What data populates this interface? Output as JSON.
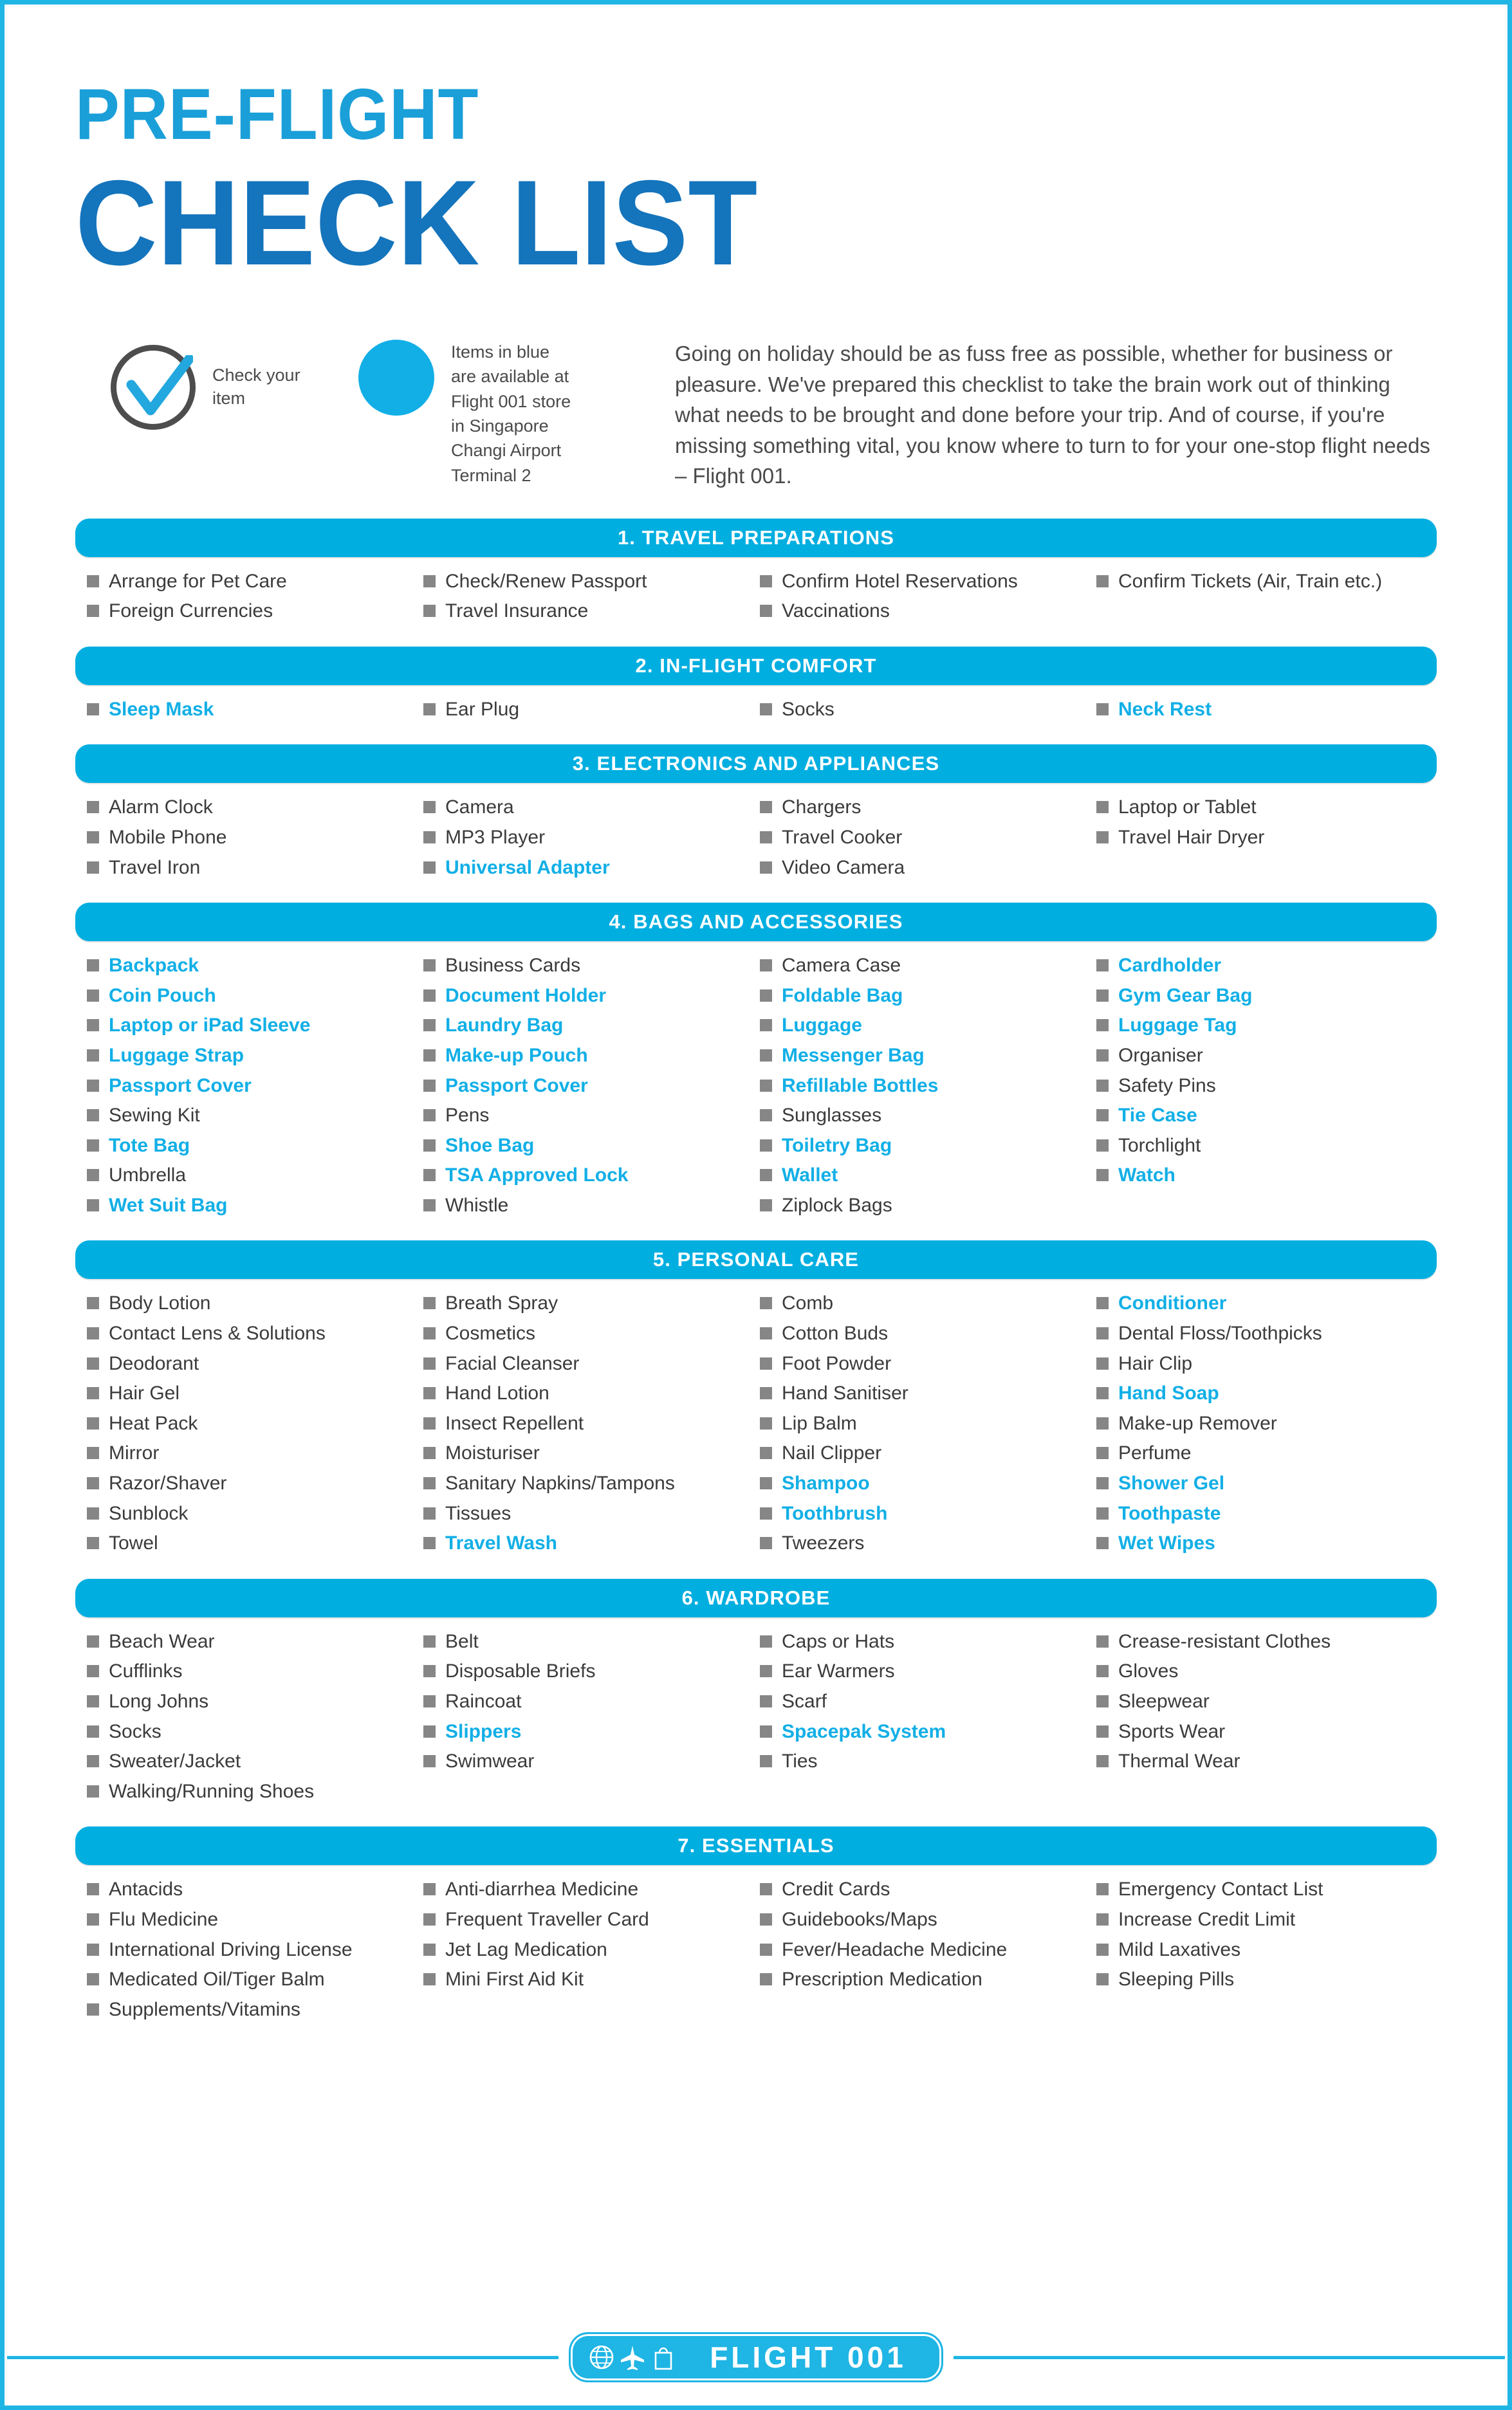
{
  "title": {
    "line1": "PRE-FLIGHT",
    "line2": "CHECK LIST",
    "color_line1": "#1B9FD8",
    "color_line2": "#1474BC"
  },
  "legend": {
    "check_icon": "check-mark-icon",
    "check_label": "Check your\nitem",
    "blue_dot_icon": "blue-dot-icon",
    "blue_label": "Items in blue\nare available at\nFlight 001 store\nin Singapore\nChangi Airport\nTerminal 2",
    "blue_color": "#12AFE6"
  },
  "intro": {
    "paragraph": "Going on holiday should be as fuss free as possible, whether for business or pleasure. We've prepared this checklist to take the brain work out of thinking what needs to be brought and done before your trip. And of course, if you're missing something vital, you know where to turn to for your one-stop flight needs – Flight 001."
  },
  "colors": {
    "section_bar": "#00AEE0",
    "highlight_text": "#12AFE6",
    "normal_text": "#3B3B3B",
    "checkbox": "#868686",
    "page_border": "#1FB5E4"
  },
  "sections": [
    {
      "title": "1. TRAVEL PREPARATIONS",
      "columns": [
        [
          {
            "label": "Arrange for Pet Care",
            "blue": false
          },
          {
            "label": "Foreign Currencies",
            "blue": false
          }
        ],
        [
          {
            "label": "Check/Renew Passport",
            "blue": false
          },
          {
            "label": "Travel Insurance",
            "blue": false
          }
        ],
        [
          {
            "label": "Confirm Hotel Reservations",
            "blue": false
          },
          {
            "label": "Vaccinations",
            "blue": false
          }
        ],
        [
          {
            "label": "Confirm Tickets (Air, Train etc.)",
            "blue": false
          }
        ]
      ]
    },
    {
      "title": "2. IN-FLIGHT COMFORT",
      "columns": [
        [
          {
            "label": "Sleep Mask",
            "blue": true
          }
        ],
        [
          {
            "label": "Ear Plug",
            "blue": false
          }
        ],
        [
          {
            "label": "Socks",
            "blue": false
          }
        ],
        [
          {
            "label": "Neck Rest",
            "blue": true
          }
        ]
      ]
    },
    {
      "title": "3. ELECTRONICS AND APPLIANCES",
      "columns": [
        [
          {
            "label": "Alarm Clock",
            "blue": false
          },
          {
            "label": "Mobile Phone",
            "blue": false
          },
          {
            "label": "Travel Iron",
            "blue": false
          }
        ],
        [
          {
            "label": "Camera",
            "blue": false
          },
          {
            "label": "MP3 Player",
            "blue": false
          },
          {
            "label": "Universal Adapter",
            "blue": true
          }
        ],
        [
          {
            "label": "Chargers",
            "blue": false
          },
          {
            "label": "Travel Cooker",
            "blue": false
          },
          {
            "label": "Video Camera",
            "blue": false
          }
        ],
        [
          {
            "label": "Laptop or Tablet",
            "blue": false
          },
          {
            "label": "Travel Hair Dryer",
            "blue": false
          }
        ]
      ]
    },
    {
      "title": "4. BAGS AND ACCESSORIES",
      "columns": [
        [
          {
            "label": "Backpack",
            "blue": true
          },
          {
            "label": "Coin Pouch",
            "blue": true
          },
          {
            "label": "Laptop or iPad Sleeve",
            "blue": true
          },
          {
            "label": "Luggage Strap",
            "blue": true
          },
          {
            "label": "Passport Cover",
            "blue": true
          },
          {
            "label": "Sewing Kit",
            "blue": false
          },
          {
            "label": "Tote Bag",
            "blue": true
          },
          {
            "label": "Umbrella",
            "blue": false
          },
          {
            "label": "Wet Suit Bag",
            "blue": true
          }
        ],
        [
          {
            "label": "Business Cards",
            "blue": false
          },
          {
            "label": "Document Holder",
            "blue": true
          },
          {
            "label": "Laundry Bag",
            "blue": true
          },
          {
            "label": "Make-up Pouch",
            "blue": true
          },
          {
            "label": "Passport Cover",
            "blue": true
          },
          {
            "label": "Pens",
            "blue": false
          },
          {
            "label": "Shoe Bag",
            "blue": true
          },
          {
            "label": "TSA Approved Lock",
            "blue": true
          },
          {
            "label": "Whistle",
            "blue": false
          }
        ],
        [
          {
            "label": "Camera Case",
            "blue": false
          },
          {
            "label": "Foldable Bag",
            "blue": true
          },
          {
            "label": "Luggage",
            "blue": true
          },
          {
            "label": "Messenger Bag",
            "blue": true
          },
          {
            "label": "Refillable Bottles",
            "blue": true
          },
          {
            "label": "Sunglasses",
            "blue": false
          },
          {
            "label": "Toiletry Bag",
            "blue": true
          },
          {
            "label": "Wallet",
            "blue": true
          },
          {
            "label": "Ziplock Bags",
            "blue": false
          }
        ],
        [
          {
            "label": "Cardholder",
            "blue": true
          },
          {
            "label": "Gym Gear Bag",
            "blue": true
          },
          {
            "label": "Luggage Tag",
            "blue": true
          },
          {
            "label": "Organiser",
            "blue": false
          },
          {
            "label": "Safety Pins",
            "blue": false
          },
          {
            "label": "Tie Case",
            "blue": true
          },
          {
            "label": "Torchlight",
            "blue": false
          },
          {
            "label": "Watch",
            "blue": true
          }
        ]
      ]
    },
    {
      "title": "5. PERSONAL CARE",
      "columns": [
        [
          {
            "label": "Body Lotion",
            "blue": false
          },
          {
            "label": "Contact Lens & Solutions",
            "blue": false
          },
          {
            "label": "Deodorant",
            "blue": false
          },
          {
            "label": "Hair Gel",
            "blue": false
          },
          {
            "label": "Heat Pack",
            "blue": false
          },
          {
            "label": "Mirror",
            "blue": false
          },
          {
            "label": "Razor/Shaver",
            "blue": false
          },
          {
            "label": "Sunblock",
            "blue": false
          },
          {
            "label": "Towel",
            "blue": false
          }
        ],
        [
          {
            "label": "Breath Spray",
            "blue": false
          },
          {
            "label": "Cosmetics",
            "blue": false
          },
          {
            "label": "Facial Cleanser",
            "blue": false
          },
          {
            "label": "Hand Lotion",
            "blue": false
          },
          {
            "label": "Insect Repellent",
            "blue": false
          },
          {
            "label": "Moisturiser",
            "blue": false
          },
          {
            "label": "Sanitary Napkins/Tampons",
            "blue": false
          },
          {
            "label": "Tissues",
            "blue": false
          },
          {
            "label": "Travel Wash",
            "blue": true
          }
        ],
        [
          {
            "label": "Comb",
            "blue": false
          },
          {
            "label": "Cotton Buds",
            "blue": false
          },
          {
            "label": "Foot Powder",
            "blue": false
          },
          {
            "label": "Hand Sanitiser",
            "blue": false
          },
          {
            "label": "Lip Balm",
            "blue": false
          },
          {
            "label": "Nail Clipper",
            "blue": false
          },
          {
            "label": "Shampoo",
            "blue": true
          },
          {
            "label": "Toothbrush",
            "blue": true
          },
          {
            "label": "Tweezers",
            "blue": false
          }
        ],
        [
          {
            "label": "Conditioner",
            "blue": true
          },
          {
            "label": "Dental Floss/Toothpicks",
            "blue": false
          },
          {
            "label": "Hair Clip",
            "blue": false
          },
          {
            "label": "Hand Soap",
            "blue": true
          },
          {
            "label": "Make-up Remover",
            "blue": false
          },
          {
            "label": "Perfume",
            "blue": false
          },
          {
            "label": "Shower Gel",
            "blue": true
          },
          {
            "label": "Toothpaste",
            "blue": true
          },
          {
            "label": "Wet Wipes",
            "blue": true
          }
        ]
      ]
    },
    {
      "title": "6. WARDROBE",
      "columns": [
        [
          {
            "label": "Beach Wear",
            "blue": false
          },
          {
            "label": "Cufflinks",
            "blue": false
          },
          {
            "label": "Long Johns",
            "blue": false
          },
          {
            "label": "Socks",
            "blue": false
          },
          {
            "label": "Sweater/Jacket",
            "blue": false
          },
          {
            "label": "Walking/Running Shoes",
            "blue": false
          }
        ],
        [
          {
            "label": "Belt",
            "blue": false
          },
          {
            "label": "Disposable Briefs",
            "blue": false
          },
          {
            "label": "Raincoat",
            "blue": false
          },
          {
            "label": "Slippers",
            "blue": true
          },
          {
            "label": "Swimwear",
            "blue": false
          }
        ],
        [
          {
            "label": "Caps or Hats",
            "blue": false
          },
          {
            "label": "Ear Warmers",
            "blue": false
          },
          {
            "label": "Scarf",
            "blue": false
          },
          {
            "label": "Spacepak System",
            "blue": true
          },
          {
            "label": "Ties",
            "blue": false
          }
        ],
        [
          {
            "label": "Crease-resistant Clothes",
            "blue": false
          },
          {
            "label": "Gloves",
            "blue": false
          },
          {
            "label": "Sleepwear",
            "blue": false
          },
          {
            "label": "Sports Wear",
            "blue": false
          },
          {
            "label": "Thermal Wear",
            "blue": false
          }
        ]
      ]
    },
    {
      "title": "7. ESSENTIALS",
      "columns": [
        [
          {
            "label": "Antacids",
            "blue": false
          },
          {
            "label": "Flu Medicine",
            "blue": false
          },
          {
            "label": "International Driving License",
            "blue": false
          },
          {
            "label": "Medicated Oil/Tiger Balm",
            "blue": false
          },
          {
            "label": "Supplements/Vitamins",
            "blue": false
          }
        ],
        [
          {
            "label": "Anti-diarrhea Medicine",
            "blue": false
          },
          {
            "label": "Frequent Traveller Card",
            "blue": false
          },
          {
            "label": "Jet Lag Medication",
            "blue": false
          },
          {
            "label": "Mini First Aid Kit",
            "blue": false
          }
        ],
        [
          {
            "label": "Credit Cards",
            "blue": false
          },
          {
            "label": "Guidebooks/Maps",
            "blue": false
          },
          {
            "label": "Fever/Headache Medicine",
            "blue": false
          },
          {
            "label": "Prescription Medication",
            "blue": false
          }
        ],
        [
          {
            "label": "Emergency Contact List",
            "blue": false
          },
          {
            "label": "Increase Credit Limit",
            "blue": false
          },
          {
            "label": "Mild Laxatives",
            "blue": false
          },
          {
            "label": "Sleeping Pills",
            "blue": false
          }
        ]
      ]
    }
  ],
  "footer": {
    "wordmark": "FLIGHT 001",
    "icons": [
      "globe-icon",
      "airplane-icon",
      "shopping-bag-icon"
    ]
  }
}
